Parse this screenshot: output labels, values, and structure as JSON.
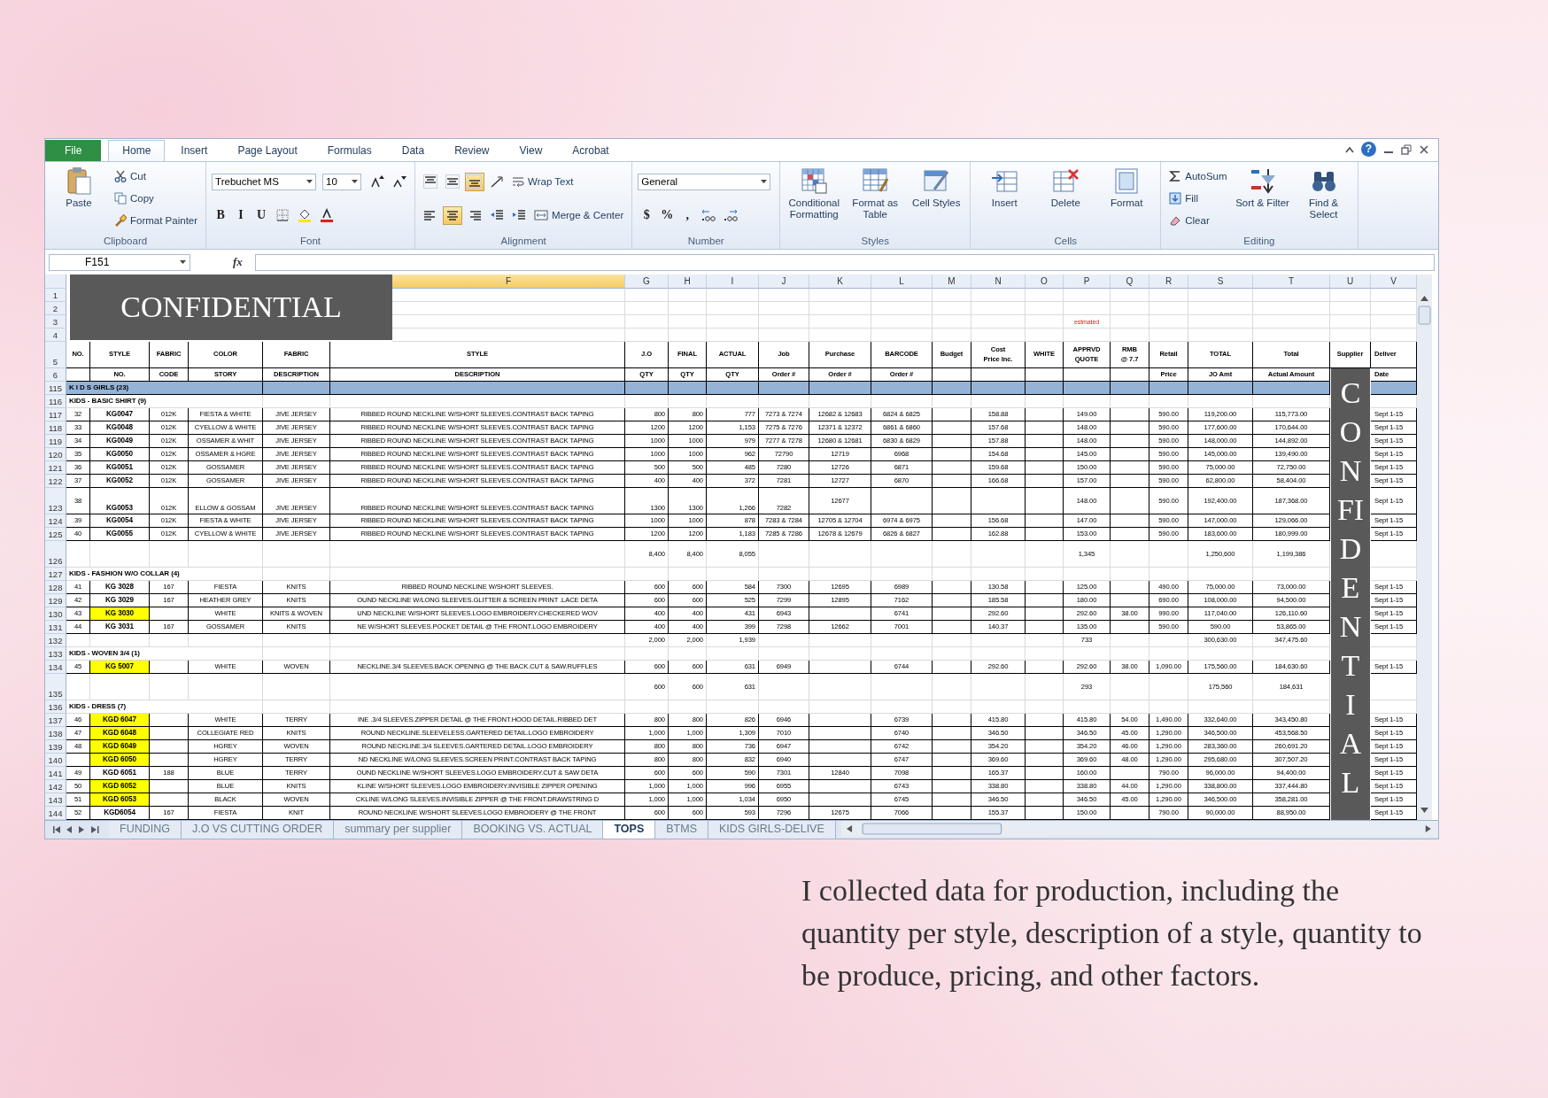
{
  "ribbon": {
    "tabs": [
      {
        "label": "File",
        "kind": "file",
        "selected": false
      },
      {
        "label": "Home",
        "kind": "tab",
        "selected": true
      },
      {
        "label": "Insert",
        "kind": "tab",
        "selected": false
      },
      {
        "label": "Page Layout",
        "kind": "tab",
        "selected": false
      },
      {
        "label": "Formulas",
        "kind": "tab",
        "selected": false
      },
      {
        "label": "Data",
        "kind": "tab",
        "selected": false
      },
      {
        "label": "Review",
        "kind": "tab",
        "selected": false
      },
      {
        "label": "View",
        "kind": "tab",
        "selected": false
      },
      {
        "label": "Acrobat",
        "kind": "tab",
        "selected": false
      }
    ],
    "help": "?",
    "groups": [
      {
        "label": "Clipboard",
        "columns": [
          {
            "kind": "large",
            "label": "Paste"
          },
          {
            "kind": "stack",
            "lines": [
              [
                {
                  "kind": "small",
                  "label": "Cut"
                }
              ],
              [
                {
                  "kind": "small",
                  "label": "Copy"
                }
              ],
              [
                {
                  "kind": "small",
                  "label": "Format Painter"
                }
              ]
            ]
          }
        ]
      },
      {
        "label": "Font",
        "columns": [
          {
            "kind": "stack",
            "lines": [
              [
                {
                  "kind": "field",
                  "value": "Trebuchet MS"
                },
                {
                  "kind": "field",
                  "value": "10"
                },
                {
                  "kind": "icon",
                  "selected": false
                },
                {
                  "kind": "icon",
                  "selected": false
                }
              ],
              [
                {
                  "kind": "glyph",
                  "label": "B"
                },
                {
                  "kind": "glyph",
                  "label": "I"
                },
                {
                  "kind": "glyph",
                  "label": "U"
                },
                {
                  "kind": "icon",
                  "selected": false
                },
                {
                  "kind": "icon",
                  "selected": false
                },
                {
                  "kind": "icon",
                  "selected": false
                }
              ]
            ]
          }
        ]
      },
      {
        "label": "Alignment",
        "columns": [
          {
            "kind": "stack",
            "lines": [
              [
                {
                  "kind": "icon",
                  "selected": false
                },
                {
                  "kind": "icon",
                  "selected": false
                },
                {
                  "kind": "icon",
                  "selected": true
                },
                {
                  "kind": "icon",
                  "selected": false
                },
                {
                  "kind": "small",
                  "label": "Wrap Text"
                }
              ],
              [
                {
                  "kind": "icon",
                  "selected": false
                },
                {
                  "kind": "icon",
                  "selected": true
                },
                {
                  "kind": "icon",
                  "selected": false
                },
                {
                  "kind": "icon",
                  "selected": false
                },
                {
                  "kind": "icon",
                  "selected": false
                },
                {
                  "kind": "small",
                  "label": "Merge & Center"
                }
              ]
            ]
          }
        ]
      },
      {
        "label": "Number",
        "columns": [
          {
            "kind": "stack",
            "lines": [
              [
                {
                  "kind": "field",
                  "value": "General"
                }
              ],
              [
                {
                  "kind": "glyph",
                  "label": "$"
                },
                {
                  "kind": "glyph",
                  "label": "%"
                },
                {
                  "kind": "glyph",
                  "label": ","
                },
                {
                  "kind": "icon",
                  "selected": false
                },
                {
                  "kind": "icon",
                  "selected": false
                }
              ]
            ]
          }
        ]
      },
      {
        "label": "Styles",
        "columns": [
          {
            "kind": "large",
            "label": "Conditional Formatting"
          },
          {
            "kind": "large",
            "label": "Format as Table"
          },
          {
            "kind": "large",
            "label": "Cell Styles"
          }
        ]
      },
      {
        "label": "Cells",
        "columns": [
          {
            "kind": "large",
            "label": "Insert"
          },
          {
            "kind": "large",
            "label": "Delete"
          },
          {
            "kind": "large",
            "label": "Format"
          }
        ]
      },
      {
        "label": "Editing",
        "columns": [
          {
            "kind": "stack",
            "lines": [
              [
                {
                  "kind": "small",
                  "label": "AutoSum"
                }
              ],
              [
                {
                  "kind": "small",
                  "label": "Fill"
                }
              ],
              [
                {
                  "kind": "small",
                  "label": "Clear"
                }
              ]
            ]
          },
          {
            "kind": "large",
            "label": "Sort & Filter"
          },
          {
            "kind": "large",
            "label": "Find & Select"
          }
        ]
      }
    ]
  },
  "formula_bar": {
    "name_box": "F151",
    "function_label": "fx"
  },
  "sheet": {
    "banner": "CONFIDENTIAL",
    "side_banner": "CONFIDENTIAL",
    "column_headers": [
      {
        "label": "F",
        "selected": true
      },
      {
        "label": "G",
        "selected": false
      },
      {
        "label": "H",
        "selected": false
      },
      {
        "label": "I",
        "selected": false
      },
      {
        "label": "J",
        "selected": false
      },
      {
        "label": "K",
        "selected": false
      },
      {
        "label": "L",
        "selected": false
      },
      {
        "label": "M",
        "selected": false
      },
      {
        "label": "N",
        "selected": false
      },
      {
        "label": "O",
        "selected": false
      },
      {
        "label": "P",
        "selected": false
      },
      {
        "label": "Q",
        "selected": false
      },
      {
        "label": "R",
        "selected": false
      },
      {
        "label": "S",
        "selected": false
      },
      {
        "label": "T",
        "selected": false
      },
      {
        "label": "U",
        "selected": false
      },
      {
        "label": "V",
        "selected": false
      }
    ],
    "rows": [
      {
        "number": "1",
        "kind": "blank",
        "tall": false
      },
      {
        "number": "2",
        "kind": "blank",
        "tall": false
      },
      {
        "number": "3",
        "kind": "note",
        "tall": false,
        "cells": {
          "P": "estmated"
        }
      },
      {
        "number": "4",
        "kind": "blank",
        "tall": false
      },
      {
        "number": "5",
        "kind": "header",
        "tall": true,
        "cells": {
          "A": "NO.",
          "B": "STYLE",
          "C": "FABRIC",
          "D": "COLOR",
          "E": "FABRIC",
          "F": "STYLE",
          "G": "J.O",
          "H": "FINAL",
          "I": "ACTUAL",
          "J": "Job",
          "K": "Purchase",
          "L": "BARCODE",
          "M": "Budget",
          "N": "Cost\nPrice Inc.",
          "O": "WHITE",
          "P": "APPRVD\nQUOTE",
          "Q": "RMB\n@ 7.7",
          "R": "Retail",
          "S": "TOTAL",
          "T": "Total",
          "U": "Supplier",
          "V": "Deliver"
        }
      },
      {
        "number": "6",
        "kind": "header",
        "tall": false,
        "cells": {
          "B": "NO.",
          "C": "CODE",
          "D": "STORY",
          "E": "DESCRIPTION",
          "F": "DESCRIPTION",
          "G": "QTY",
          "H": "QTY",
          "I": "QTY",
          "J": "Order #",
          "K": "Order #",
          "L": "Order #",
          "R": "Price",
          "S": "JO Amt",
          "T": "Actual Amount",
          "V": "Date"
        }
      },
      {
        "number": "115",
        "kind": "band",
        "tall": false,
        "cells": {
          "A": "K I D S GIRLS (23)"
        }
      },
      {
        "number": "116",
        "kind": "section",
        "tall": false,
        "cells": {
          "A": "KIDS - BASIC SHIRT (9)"
        }
      },
      {
        "number": "117",
        "kind": "item",
        "tall": false,
        "highlighted": false,
        "cells": {
          "A": "32",
          "B": "KG0047",
          "C": "012K",
          "D": "FIESTA & WHITE",
          "E": "JIVE JERSEY",
          "F": "RIBBED ROUND NECKLINE W/SHORT SLEEVES.CONTRAST BACK TAPING",
          "G": "800",
          "H": "800",
          "I": "777",
          "J": "7273 & 7274",
          "K": "12682 & 12683",
          "L": "6824 & 6825",
          "N": "158.88",
          "P": "149.00",
          "R": "590.00",
          "S": "119,200.00",
          "T": "115,773.00",
          "V": "Sept 1-15"
        }
      },
      {
        "number": "118",
        "kind": "item",
        "tall": false,
        "highlighted": false,
        "cells": {
          "A": "33",
          "B": "KG0048",
          "C": "012K",
          "D": "CYELLOW & WHITE",
          "E": "JIVE JERSEY",
          "F": "RIBBED ROUND NECKLINE W/SHORT SLEEVES.CONTRAST BACK TAPING",
          "G": "1200",
          "H": "1200",
          "I": "1,153",
          "J": "7275 & 7276",
          "K": "12371 & 12372",
          "L": "6861 & 6860",
          "N": "157.68",
          "P": "148.00",
          "R": "590.00",
          "S": "177,600.00",
          "T": "170,644.00",
          "V": "Sept 1-15"
        }
      },
      {
        "number": "119",
        "kind": "item",
        "tall": false,
        "highlighted": false,
        "cells": {
          "A": "34",
          "B": "KG0049",
          "C": "012K",
          "D": "OSSAMER & WHIT",
          "E": "JIVE JERSEY",
          "F": "RIBBED ROUND NECKLINE W/SHORT SLEEVES.CONTRAST BACK TAPING",
          "G": "1000",
          "H": "1000",
          "I": "979",
          "J": "7277 & 7278",
          "K": "12680 & 12681",
          "L": "6830 & 6829",
          "N": "157.88",
          "P": "148.00",
          "R": "590.00",
          "S": "148,000.00",
          "T": "144,892.00",
          "V": "Sept 1-15"
        }
      },
      {
        "number": "120",
        "kind": "item",
        "tall": false,
        "highlighted": false,
        "cells": {
          "A": "35",
          "B": "KG0050",
          "C": "012K",
          "D": "OSSAMER & HGRE",
          "E": "JIVE JERSEY",
          "F": "RIBBED ROUND NECKLINE W/SHORT SLEEVES.CONTRAST BACK TAPING",
          "G": "1000",
          "H": "1000",
          "I": "962",
          "J": "72790",
          "K": "12719",
          "L": "6968",
          "N": "154.68",
          "P": "145.00",
          "R": "590.00",
          "S": "145,000.00",
          "T": "139,490.00",
          "V": "Sept 1-15"
        }
      },
      {
        "number": "121",
        "kind": "item",
        "tall": false,
        "highlighted": false,
        "cells": {
          "A": "36",
          "B": "KG0051",
          "C": "012K",
          "D": "GOSSAMER",
          "E": "JIVE JERSEY",
          "F": "RIBBED ROUND NECKLINE W/SHORT SLEEVES.CONTRAST BACK TAPING",
          "G": "500",
          "H": "500",
          "I": "485",
          "J": "7280",
          "K": "12726",
          "L": "6871",
          "N": "159.68",
          "P": "150.00",
          "R": "590.00",
          "S": "75,000.00",
          "T": "72,750.00",
          "V": "Sept 1-15"
        }
      },
      {
        "number": "122",
        "kind": "item",
        "tall": false,
        "highlighted": false,
        "cells": {
          "A": "37",
          "B": "KG0052",
          "C": "012K",
          "D": "GOSSAMER",
          "E": "JIVE JERSEY",
          "F": "RIBBED ROUND NECKLINE W/SHORT SLEEVES.CONTRAST BACK TAPING",
          "G": "400",
          "H": "400",
          "I": "372",
          "J": "7281",
          "K": "12727",
          "L": "6870",
          "N": "166.68",
          "P": "157.00",
          "R": "590.00",
          "S": "62,800.00",
          "T": "58,404.00",
          "V": "Sept 1-15"
        }
      },
      {
        "number": "123",
        "kind": "item",
        "tall": true,
        "highlighted": false,
        "cells": {
          "A": "38",
          "B": "KG0053",
          "C": "012K",
          "D": "ELLOW & GOSSAM",
          "E": "JIVE JERSEY",
          "F": "RIBBED ROUND NECKLINE W/SHORT SLEEVES.CONTRAST BACK TAPING",
          "G": "1300",
          "H": "1300",
          "I": "1,266",
          "J": "7282",
          "K": "12677",
          "P": "148.00",
          "R": "590.00",
          "S": "192,400.00",
          "T": "187,368.00",
          "V": "Sept 1-15"
        }
      },
      {
        "number": "124",
        "kind": "item",
        "tall": false,
        "highlighted": false,
        "cells": {
          "A": "39",
          "B": "KG0054",
          "C": "012K",
          "D": "FIESTA & WHITE",
          "E": "JIVE JERSEY",
          "F": "RIBBED ROUND NECKLINE W/SHORT SLEEVES.CONTRAST BACK TAPING",
          "G": "1000",
          "H": "1000",
          "I": "878",
          "J": "7283 & 7284",
          "K": "12705 & 12704",
          "L": "6974 & 6975",
          "N": "156.68",
          "P": "147.00",
          "R": "590.00",
          "S": "147,000.00",
          "T": "129,066.00",
          "V": "Sept 1-15"
        }
      },
      {
        "number": "125",
        "kind": "item",
        "tall": false,
        "highlighted": false,
        "cells": {
          "A": "40",
          "B": "KG0055",
          "C": "012K",
          "D": "CYELLOW & WHITE",
          "E": "JIVE JERSEY",
          "F": "RIBBED ROUND NECKLINE W/SHORT SLEEVES.CONTRAST BACK TAPING",
          "G": "1200",
          "H": "1200",
          "I": "1,183",
          "J": "7285 & 7286",
          "K": "12678 & 12679",
          "L": "6826 & 6827",
          "N": "162.88",
          "P": "153.00",
          "R": "590.00",
          "S": "183,600.00",
          "T": "180,999.00",
          "V": "Sept 1-15"
        }
      },
      {
        "number": "126",
        "kind": "total",
        "tall": true,
        "cells": {
          "G": "8,400",
          "H": "8,400",
          "I": "8,055",
          "P": "1,345",
          "S": "1,250,600",
          "T": "1,199,386"
        }
      },
      {
        "number": "127",
        "kind": "section",
        "tall": false,
        "cells": {
          "A": "KIDS - FASHION W/O COLLAR (4)"
        }
      },
      {
        "number": "128",
        "kind": "item",
        "tall": false,
        "highlighted": false,
        "cells": {
          "A": "41",
          "B": "KG 3028",
          "C": "167",
          "D": "FIESTA",
          "E": "KNITS",
          "F": "RIBBED ROUND NECKLINE W/SHORT SLEEVES.",
          "G": "600",
          "H": "600",
          "I": "584",
          "J": "7300",
          "K": "12695",
          "L": "6989",
          "N": "130.58",
          "P": "125.00",
          "R": "490.00",
          "S": "75,000.00",
          "T": "73,000.00",
          "V": "Sept 1-15"
        }
      },
      {
        "number": "129",
        "kind": "item",
        "tall": false,
        "highlighted": false,
        "cells": {
          "A": "42",
          "B": "KG 3029",
          "C": "167",
          "D": "HEATHER GREY",
          "E": "KNITS",
          "F": "OUND NECKLINE W/LONG SLEEVES.GLITTER & SCREEN PRINT .LACE DETA",
          "G": "600",
          "H": "600",
          "I": "525",
          "J": "7299",
          "K": "12895",
          "L": "7162",
          "N": "185.58",
          "P": "180.00",
          "R": "690.00",
          "S": "108,000.00",
          "T": "94,500.00",
          "V": "Sept 1-15"
        }
      },
      {
        "number": "130",
        "kind": "item",
        "tall": false,
        "highlighted": true,
        "cells": {
          "A": "43",
          "B": "KG 3030",
          "D": "WHITE",
          "E": "KNITS & WOVEN",
          "F": "UND NECKLINE W/SHORT SLEEVES.LOGO EMBROIDERY.CHECKERED WOV",
          "G": "400",
          "H": "400",
          "I": "431",
          "J": "6943",
          "L": "6741",
          "N": "292.60",
          "P": "292.60",
          "Q": "38.00",
          "R": "990.00",
          "S": "117,040.00",
          "T": "126,110.60",
          "V": "Sept 1-15"
        }
      },
      {
        "number": "131",
        "kind": "item",
        "tall": false,
        "highlighted": false,
        "cells": {
          "A": "44",
          "B": "KG 3031",
          "C": "167",
          "D": "GOSSAMER",
          "E": "KNITS",
          "F": "NE W/SHORT SLEEVES.POCKET DETAIL @ THE FRONT.LOGO EMBROIDERY",
          "G": "400",
          "H": "400",
          "I": "399",
          "J": "7298",
          "K": "12662",
          "L": "7001",
          "N": "140.37",
          "P": "135.00",
          "R": "590.00",
          "S": "590.00",
          "T": "53,865.00",
          "V": "Sept 1-15"
        }
      },
      {
        "number": "132",
        "kind": "total",
        "tall": false,
        "cells": {
          "G": "2,000",
          "H": "2,000",
          "I": "1,939",
          "P": "733",
          "S": "300,630.00",
          "T": "347,475.60"
        }
      },
      {
        "number": "133",
        "kind": "section",
        "tall": false,
        "cells": {
          "A": "KIDS - WOVEN 3/4 (1)"
        }
      },
      {
        "number": "134",
        "kind": "item",
        "tall": false,
        "highlighted": true,
        "cells": {
          "A": "45",
          "B": "KG 5007",
          "D": "WHITE",
          "E": "WOVEN",
          "F": "NECKLINE.3/4 SLEEVES.BACK OPENING @ THE BACK.CUT & SAW.RUFFLES",
          "G": "600",
          "H": "600",
          "I": "631",
          "J": "6949",
          "L": "6744",
          "N": "292.60",
          "P": "292.60",
          "Q": "38.00",
          "R": "1,090.00",
          "S": "175,560.00",
          "T": "184,630.60",
          "V": "Sept 1-15"
        }
      },
      {
        "number": "135",
        "kind": "total",
        "tall": true,
        "cells": {
          "G": "600",
          "H": "600",
          "I": "631",
          "P": "293",
          "S": "175,560",
          "T": "184,631"
        }
      },
      {
        "number": "136",
        "kind": "section",
        "tall": false,
        "cells": {
          "A": "KIDS - DRESS (7)"
        }
      },
      {
        "number": "137",
        "kind": "item",
        "tall": false,
        "highlighted": true,
        "cells": {
          "A": "46",
          "B": "KGD 6047",
          "D": "WHITE",
          "E": "TERRY",
          "F": "INE .3/4 SLEEVES.ZIPPER DETAIL @ THE FRONT.HOOD DETAIL.RIBBED DET",
          "G": "800",
          "H": "800",
          "I": "826",
          "J": "6946",
          "L": "6739",
          "N": "415.80",
          "P": "415.80",
          "Q": "54.00",
          "R": "1,490.00",
          "S": "332,640.00",
          "T": "343,450.80",
          "V": "Sept 1-15"
        }
      },
      {
        "number": "138",
        "kind": "item",
        "tall": false,
        "highlighted": true,
        "cells": {
          "A": "47",
          "B": "KGD 6048",
          "D": "COLLEGIATE RED",
          "E": "KNITS",
          "F": "ROUND NECKLINE.SLEEVELESS.GARTERED DETAIL.LOGO EMBROIDERY",
          "G": "1,000",
          "H": "1,000",
          "I": "1,309",
          "J": "7010",
          "L": "6740",
          "N": "346.50",
          "P": "346.50",
          "Q": "45.00",
          "R": "1,290.00",
          "S": "346,500.00",
          "T": "453,568.50",
          "V": "Sept 1-15"
        }
      },
      {
        "number": "139",
        "kind": "item",
        "tall": false,
        "highlighted": true,
        "cells": {
          "A": "48",
          "B": "KGD 6049",
          "D": "HGREY",
          "E": "WOVEN",
          "F": "ROUND NECKLINE.3/4 SLEEVES.GARTERED DETAIL.LOGO EMBROIDERY",
          "G": "800",
          "H": "800",
          "I": "736",
          "J": "6947",
          "L": "6742",
          "N": "354.20",
          "P": "354.20",
          "Q": "46.00",
          "R": "1,290.00",
          "S": "283,360.00",
          "T": "260,691.20",
          "V": "Sept 1-15"
        }
      },
      {
        "number": "140",
        "kind": "item",
        "tall": false,
        "highlighted": true,
        "cells": {
          "B": "KGD 6050",
          "D": "HGREY",
          "E": "TERRY",
          "F": "ND NECKLINE W/LONG SLEEVES.SCREEN PRINT.CONTRAST BACK TAPING",
          "G": "800",
          "H": "800",
          "I": "832",
          "J": "6940",
          "L": "6747",
          "N": "369.60",
          "P": "369.60",
          "Q": "48.00",
          "R": "1,290.00",
          "S": "295,680.00",
          "T": "307,507.20",
          "V": "Sept 1-15"
        }
      },
      {
        "number": "141",
        "kind": "item",
        "tall": false,
        "highlighted": false,
        "cells": {
          "A": "49",
          "B": "KGD 6051",
          "C": "188",
          "D": "BLUE",
          "E": "TERRY",
          "F": "OUND NECKLINE W/SHORT SLEEVES.LOGO EMBROIDERY.CUT & SAW DETA",
          "G": "600",
          "H": "600",
          "I": "590",
          "J": "7301",
          "K": "12840",
          "L": "7098",
          "N": "165.37",
          "P": "160.00",
          "R": "790.00",
          "S": "96,000.00",
          "T": "94,400.00",
          "V": "Sept 1-15"
        }
      },
      {
        "number": "142",
        "kind": "item",
        "tall": false,
        "highlighted": true,
        "cells": {
          "A": "50",
          "B": "KGD 6052",
          "D": "BLUE",
          "E": "KNITS",
          "F": "KLINE W/SHORT SLEEVES.LOGO EMBROIDERY.INVISIBLE ZIPPER OPENING",
          "G": "1,000",
          "H": "1,000",
          "I": "996",
          "J": "6955",
          "L": "6743",
          "N": "338.80",
          "P": "338.80",
          "Q": "44.00",
          "R": "1,290.00",
          "S": "338,800.00",
          "T": "337,444.80",
          "V": "Sept 1-15"
        }
      },
      {
        "number": "143",
        "kind": "item",
        "tall": false,
        "highlighted": true,
        "cells": {
          "A": "51",
          "B": "KGD 6053",
          "D": "BLACK",
          "E": "WOVEN",
          "F": "CKLINE W/LONG SLEEVES.INVISIBLE ZIPPER @ THE FRONT.DRAWSTRING D",
          "G": "1,000",
          "H": "1,000",
          "I": "1,034",
          "J": "6950",
          "L": "6745",
          "N": "346.50",
          "P": "346.50",
          "Q": "45.00",
          "R": "1,290.00",
          "S": "346,500.00",
          "T": "358,281.00",
          "V": "Sept 1-15"
        }
      },
      {
        "number": "144",
        "kind": "item",
        "tall": false,
        "highlighted": false,
        "cells": {
          "A": "52",
          "B": "KGD6054",
          "C": "167",
          "D": "FIESTA",
          "E": "KNIT",
          "F": "ROUND NECKLINE W/SHORT SLEEVES.LOGO EMBROIDERY @ THE FRONT",
          "G": "600",
          "H": "600",
          "I": "593",
          "J": "7296",
          "K": "12675",
          "L": "7066",
          "N": "155.37",
          "P": "150.00",
          "R": "790.00",
          "S": "90,000.00",
          "T": "88,950.00",
          "V": "Sept 1-15"
        }
      }
    ]
  },
  "sheet_tabs": [
    {
      "label": "FUNDING",
      "selected": false
    },
    {
      "label": "J.O VS CUTTING ORDER",
      "selected": false
    },
    {
      "label": "summary per supplier",
      "selected": false
    },
    {
      "label": "BOOKING VS. ACTUAL",
      "selected": false
    },
    {
      "label": "TOPS",
      "selected": true
    },
    {
      "label": "BTMS",
      "selected": false
    },
    {
      "label": "KIDS GIRLS-DELIVE",
      "selected": false
    }
  ],
  "caption": "I collected data for production, including the quantity per style, description of a style, quantity to be produce, pricing, and other factors."
}
